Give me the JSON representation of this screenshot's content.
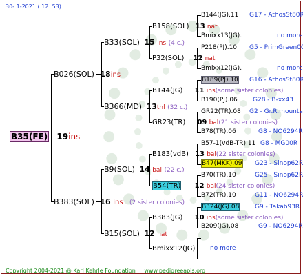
{
  "header": {
    "text": "30-   1-2021  ( 12:  53)"
  },
  "footer": {
    "copyright": "Copyright 2004-2021 @ Karl Kehrle Foundation",
    "url": "www.pedigreeapis.org"
  },
  "colors": {
    "root_bg": "#f2c6ee",
    "ins": "#c81414",
    "nat": "#c81414",
    "note": "#8a5cc0",
    "link": "#1e3cd2",
    "highlight_cyan": "#3cd0e0",
    "highlight_yellow": "#f0f000",
    "highlight_gray": "#b8b8c0"
  },
  "root": {
    "name": "B35(FE)",
    "gen": "19",
    "mark": "ins"
  },
  "gen1": [
    {
      "name": "B026(SOL)",
      "gen": "18",
      "mark": "ins"
    },
    {
      "name": "B383(SOL)",
      "gen": "16",
      "mark": "ins",
      "note": "(2 sister colonies)"
    }
  ],
  "gen2": [
    {
      "name": "B33(SOL)",
      "gen": "15",
      "mark": "ins",
      "note": "(4 c.)"
    },
    {
      "name": "B366(MD)",
      "gen": "13",
      "mark": "thl",
      "note": "(32 c.)"
    },
    {
      "name": "B9(SOL)",
      "gen": "14",
      "mark": "bal",
      "note": "(22 c.)"
    },
    {
      "name": "B15(SOL)",
      "gen": "12",
      "mark": "nat"
    }
  ],
  "gen3": [
    {
      "name": "B158(SOL)",
      "gen": "13",
      "mark": "nat"
    },
    {
      "name": "P32(SOL)",
      "gen": "12",
      "mark": "nat"
    },
    {
      "name": "B144(JG)",
      "gen": "11",
      "mark": "ins",
      "note": "(some sister colonies)"
    },
    {
      "name": "GR23(TR)",
      "gen": "09",
      "mark": "bal",
      "note": "(21 sister colonies)"
    },
    {
      "name": "B183(vdB)",
      "gen": "13",
      "mark": "bal",
      "note": "(22 sister colonies)"
    },
    {
      "name": "B54(TR)",
      "gen": "12",
      "mark": "bal",
      "note": "(24 sister colonies)"
    },
    {
      "name": "B383(JG)",
      "gen": "10",
      "mark": "ins",
      "note": "(some sister colonies)"
    },
    {
      "name": "Bmixx12(JG)"
    }
  ],
  "gen4": [
    {
      "name": "B144(JG).11",
      "info": "G17 - AthosSt80R"
    },
    {
      "name": "Bmixx13(JG).",
      "info": "no more"
    },
    {
      "name": "P218(PJ).10",
      "info": "G5 - PrimGreen00"
    },
    {
      "name": "Bmixx12(JG).",
      "info": "no more"
    },
    {
      "name": "B189(PJ).10",
      "info": "G16 - AthosSt80R"
    },
    {
      "name": "B190(PJ).06",
      "info": "G28 - B-xx43"
    },
    {
      "name": "GR22(TR).08",
      "info": "G2 - Gr.R.mounta"
    },
    {
      "name": "B78(TR).06",
      "info": "G8 - NO6294R"
    },
    {
      "name": "B57-1(vdB-TR).11",
      "info": "G8 - MG00R"
    },
    {
      "name": "B47(MKK).09",
      "info": "G23 - Sinop62R"
    },
    {
      "name": "B70(TR).10",
      "info": "G25 - Sinop62R"
    },
    {
      "name": "B72(TR).10",
      "info": "G11 - NO6294R"
    },
    {
      "name": "B324(JG).08",
      "info": "G9 - Takab93R"
    },
    {
      "name": "B209(JG).08",
      "info": "G9 - NO6294R"
    }
  ],
  "end_note": "no more"
}
